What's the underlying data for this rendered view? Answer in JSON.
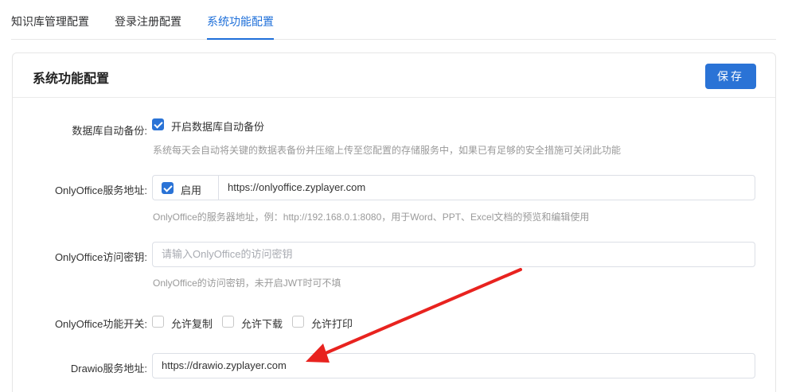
{
  "tabs": [
    {
      "label": "知识库管理配置"
    },
    {
      "label": "登录注册配置"
    },
    {
      "label": "系统功能配置"
    }
  ],
  "card": {
    "title": "系统功能配置",
    "save_label": "保存"
  },
  "form": {
    "backup": {
      "label": "数据库自动备份:",
      "checkbox_label": "开启数据库自动备份",
      "checked": true,
      "hint": "系统每天会自动将关键的数据表备份并压缩上传至您配置的存储服务中，如果已有足够的安全措施可关闭此功能"
    },
    "onlyoffice_url": {
      "label": "OnlyOffice服务地址:",
      "enable_label": "启用",
      "enabled": true,
      "value": "https://onlyoffice.zyplayer.com",
      "hint": "OnlyOffice的服务器地址，例：http://192.168.0.1:8080，用于Word、PPT、Excel文档的预览和编辑使用"
    },
    "onlyoffice_key": {
      "label": "OnlyOffice访问密钥:",
      "placeholder": "请输入OnlyOffice的访问密钥",
      "hint": "OnlyOffice的访问密钥，未开启JWT时可不填"
    },
    "onlyoffice_switch": {
      "label": "OnlyOffice功能开关:",
      "options": [
        {
          "label": "允许复制",
          "checked": false
        },
        {
          "label": "允许下载",
          "checked": false
        },
        {
          "label": "允许打印",
          "checked": false
        }
      ]
    },
    "drawio_url": {
      "label": "Drawio服务地址:",
      "value": "https://drawio.zyplayer.com"
    }
  },
  "colors": {
    "accent": "#2a73d6",
    "annotation_arrow": "#e8231f"
  }
}
